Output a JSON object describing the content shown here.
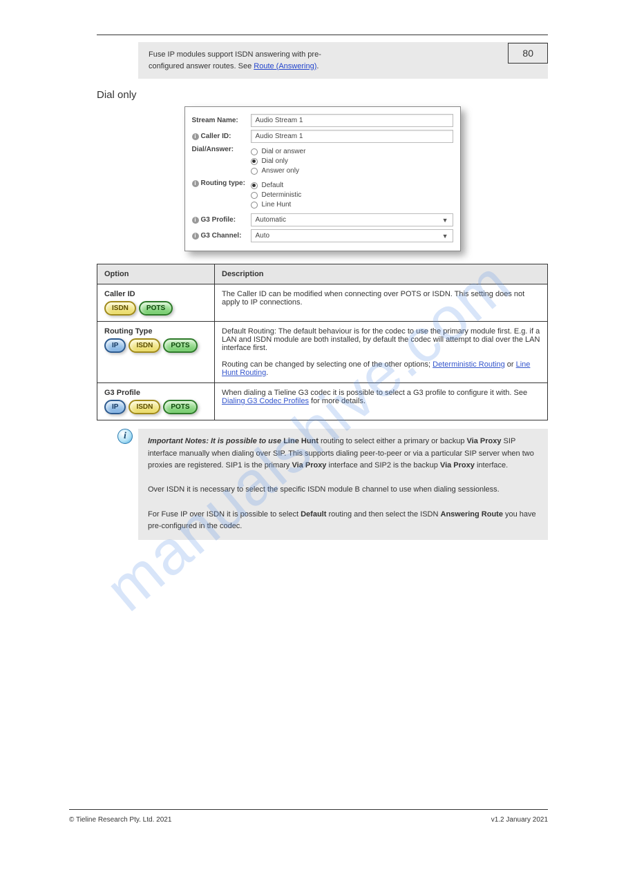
{
  "page_number": "80",
  "top_note": {
    "text_before": "Fuse IP modules support ISDN answering with pre-",
    "text_after": "configured answer routes. See ",
    "link": "Route (Answering)",
    "trailing": "."
  },
  "section_title": "Dial only",
  "form": {
    "stream_name_label": "Stream Name:",
    "stream_name_value": "Audio Stream 1",
    "caller_id_label": "Caller ID:",
    "caller_id_value": "Audio Stream 1",
    "dial_answer_label": "Dial/Answer:",
    "dial_answer_opts": [
      "Dial or answer",
      "Dial only",
      "Answer only"
    ],
    "dial_answer_selected": 1,
    "routing_label": "Routing type:",
    "routing_opts": [
      "Default",
      "Deterministic",
      "Line Hunt"
    ],
    "routing_selected": 0,
    "g3prof_label": "G3 Profile:",
    "g3prof_value": "Automatic",
    "g3chan_label": "G3 Channel:",
    "g3chan_value": "Auto"
  },
  "table": {
    "h1": "Option",
    "h2": "Description",
    "rows": [
      {
        "badges": [
          "isdn",
          "pots"
        ],
        "name": "Caller ID",
        "desc": "The Caller ID can be modified when connecting over POTS or ISDN. This setting does not apply to IP connections."
      },
      {
        "badges": [
          "ip",
          "isdn",
          "pots"
        ],
        "name": "Routing Type",
        "desc_a": "Default Routing: The default behaviour is for the codec to use the primary module first. E.g. if a LAN and ISDN module are both installed, by default the codec will attempt to dial over the LAN interface first.",
        "desc_b": "Routing can be changed by selecting one of the other options; ",
        "link1": "Deterministic Routing",
        "mid": " or ",
        "link2": "Line Hunt Routing",
        "tail": "."
      },
      {
        "badges": [
          "ip",
          "isdn",
          "pots"
        ],
        "name": "G3 Profile",
        "desc": "When dialing a Tieline G3 codec it is possible to select a G3 profile to configure it with. See ",
        "link": "Dialing G3 Codec Profiles",
        "tail": " for more details."
      }
    ]
  },
  "info": {
    "p1_a": "Important Notes: It is possible to use ",
    "p1_b": "Line Hunt",
    "p1_c": " routing to select either a primary or backup ",
    "p1_d": "Via Proxy",
    "p1_e": " SIP interface manually when dialing over SIP. This supports dialing peer-to-peer or via a particular SIP server when two proxies are registered. SIP1 is the primary ",
    "p1_f": "Via Proxy",
    "p1_g": " interface and SIP2 is the backup ",
    "p1_h": "Via Proxy",
    "p1_i": " interface.",
    "p2": "Over ISDN it is necessary to select the specific ISDN module B channel to use when dialing sessionless.",
    "p3_a": "For Fuse IP over ISDN it is possible to select ",
    "p3_b": "Default",
    "p3_c": " routing and then select the ISDN ",
    "p3_d": "Answering Route",
    "p3_e": " you have pre-configured in the codec."
  },
  "footer": {
    "left": "© Tieline Research Pty. Ltd. 2021",
    "right": "v1.2 January 2021"
  }
}
